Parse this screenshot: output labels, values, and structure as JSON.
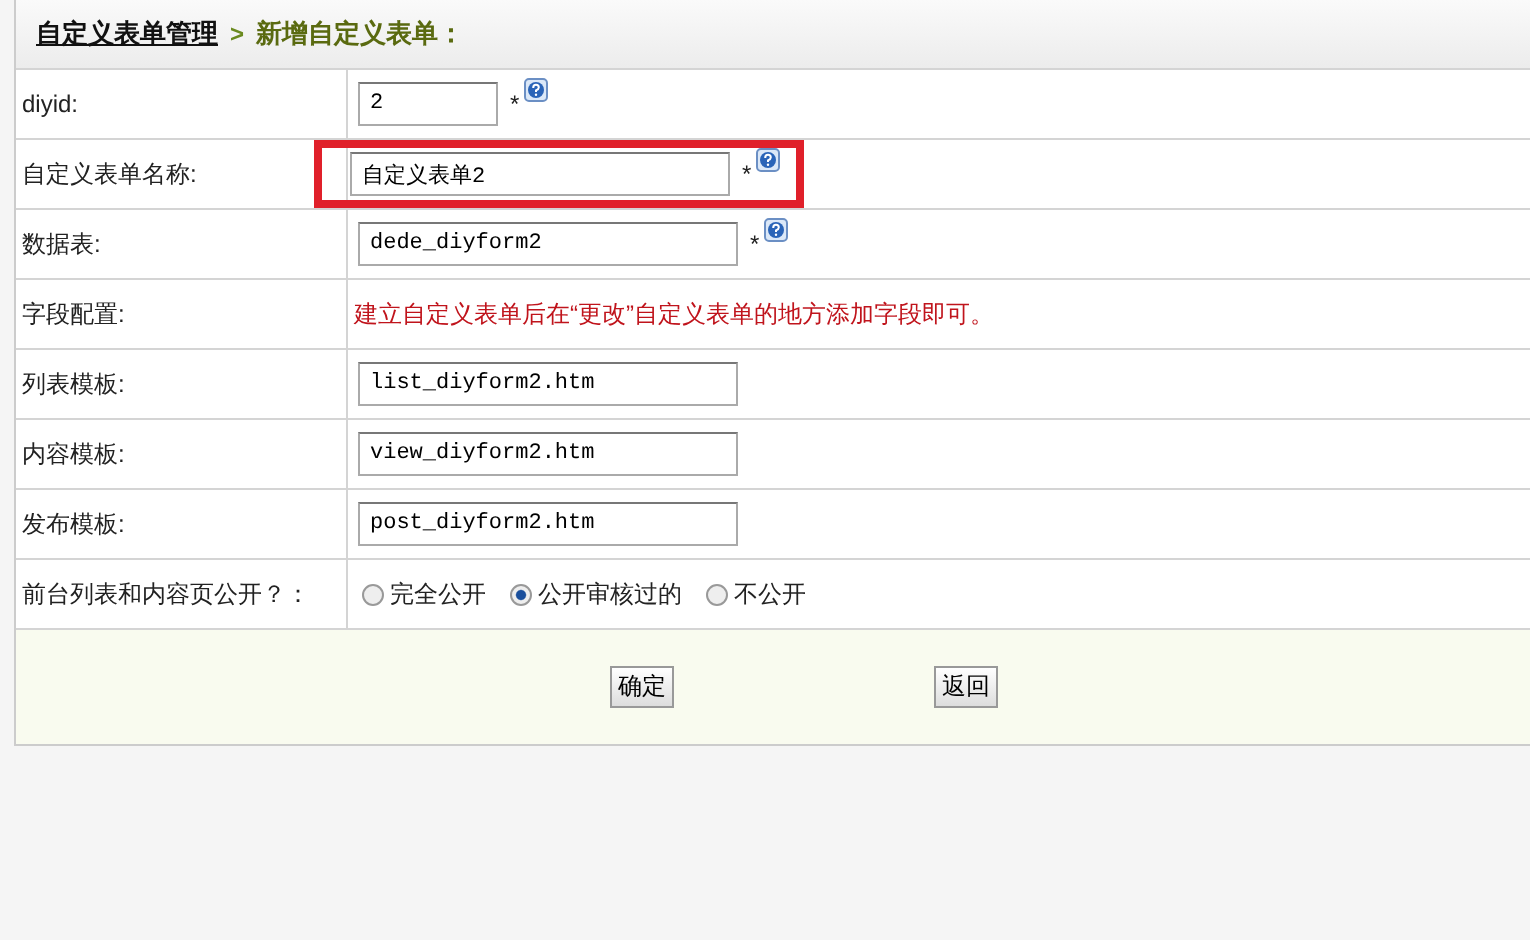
{
  "breadcrumb": {
    "link": "自定义表单管理",
    "separator": ">",
    "current": "新增自定义表单："
  },
  "rows": [
    {
      "kind": "short-input",
      "label": "diyid:",
      "value": "2",
      "required": "*",
      "help": true,
      "highlighted": false
    },
    {
      "kind": "input",
      "label": "自定义表单名称:",
      "value": "自定义表单2",
      "required": "*",
      "help": true,
      "highlighted": true
    },
    {
      "kind": "input",
      "label": "数据表:",
      "value": "dede_diyform2",
      "required": "*",
      "help": true,
      "highlighted": false
    },
    {
      "kind": "note",
      "label": "字段配置:",
      "text": "建立自定义表单后在“更改”自定义表单的地方添加字段即可。"
    },
    {
      "kind": "input",
      "label": "列表模板:",
      "value": "list_diyform2.htm",
      "highlighted": false
    },
    {
      "kind": "input",
      "label": "内容模板:",
      "value": "view_diyform2.htm",
      "highlighted": false
    },
    {
      "kind": "input",
      "label": "发布模板:",
      "value": "post_diyform2.htm",
      "highlighted": false
    },
    {
      "kind": "radio",
      "label": "前台列表和内容页公开？：",
      "options": [
        {
          "label": "完全公开",
          "selected": false
        },
        {
          "label": "公开审核过的",
          "selected": true
        },
        {
          "label": "不公开",
          "selected": false
        }
      ]
    }
  ],
  "buttons": [
    "确定",
    "返回"
  ]
}
